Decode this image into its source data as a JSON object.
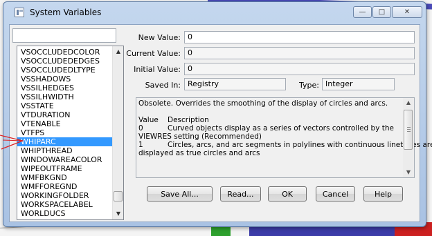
{
  "window": {
    "title": "System Variables"
  },
  "title_controls": {
    "minimize": "—",
    "maximize": "□",
    "close": "✕"
  },
  "search": {
    "value": ""
  },
  "variables": {
    "items": [
      "VSOCCLUDEDCOLOR",
      "VSOCCLUDEDEDGES",
      "VSOCCLUDEDLTYPE",
      "VSSHADOWS",
      "VSSILHEDGES",
      "VSSILHWIDTH",
      "VSSTATE",
      "VTDURATION",
      "VTENABLE",
      "VTFPS",
      "WHIPARC",
      "WHIPTHREAD",
      "WINDOWAREACOLOR",
      "WIPEOUTFRAME",
      "WMFBKGND",
      "WMFFOREGND",
      "WORKINGFOLDER",
      "WORKSPACELABEL",
      "WORLDUCS"
    ],
    "selected": "WHIPARC"
  },
  "fields": {
    "new_value_label": "New Value:",
    "new_value": "0",
    "current_value_label": "Current Value:",
    "current_value": "0",
    "initial_value_label": "Initial Value:",
    "initial_value": "0",
    "saved_in_label": "Saved In:",
    "saved_in": "Registry",
    "type_label": "Type:",
    "type": "Integer"
  },
  "description": {
    "summary": "Obsolete. Overrides the smoothing of the display of circles and arcs.",
    "header_value": "Value",
    "header_description": "Description",
    "row0_value": "0",
    "row0_text": "Curved objects display as a series of vectors controlled by the",
    "row0_cont": "VIEWRES setting (Recommended)",
    "row1_value": "1",
    "row1_text": "Circles, arcs, and arc segments in polylines with continuous linetypes are",
    "row1_cont": "displayed as true circles and arcs"
  },
  "buttons": {
    "save_all": "Save All...",
    "read": "Read...",
    "ok": "OK",
    "cancel": "Cancel",
    "help": "Help"
  },
  "colors": {
    "selection": "#3399ff",
    "annotation_arrow": "#e02020"
  }
}
